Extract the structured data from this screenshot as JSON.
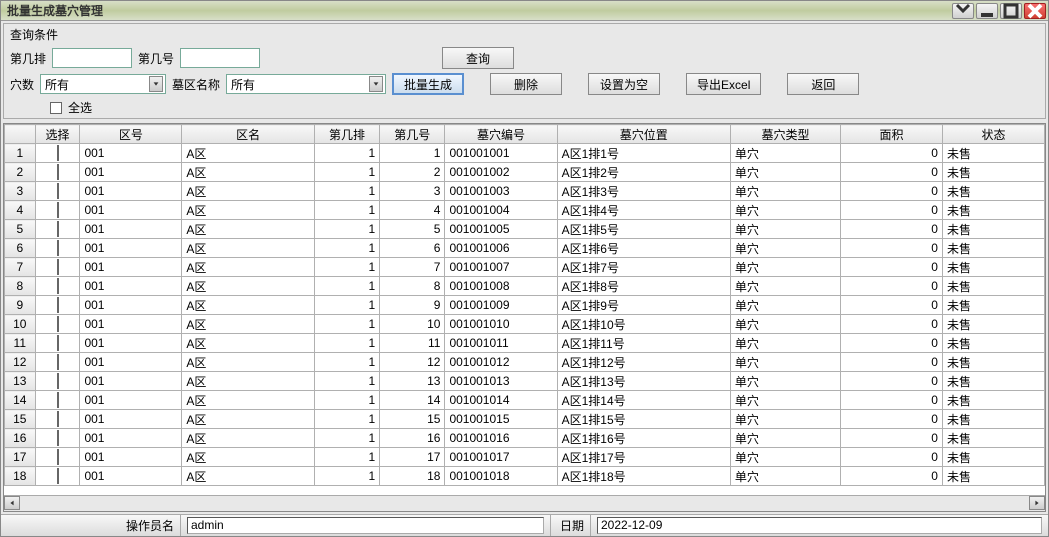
{
  "window": {
    "title": "批量生成墓穴管理"
  },
  "filter": {
    "section_label": "查询条件",
    "row_label": "第几排",
    "col_label": "第几号",
    "row_value": "",
    "col_value": "",
    "holes_label": "穴数",
    "holes_value": "所有",
    "area_name_label": "墓区名称",
    "area_name_value": "所有",
    "select_all_label": "全选"
  },
  "buttons": {
    "query": "查询",
    "batch_gen": "批量生成",
    "delete": "删除",
    "set_empty": "设置为空",
    "export_excel": "导出Excel",
    "back": "返回"
  },
  "columns": [
    "",
    "选择",
    "区号",
    "区名",
    "第几排",
    "第几号",
    "墓穴编号",
    "墓穴位置",
    "墓穴类型",
    "面积",
    "状态"
  ],
  "rows": [
    {
      "idx": 1,
      "areaNo": "001",
      "areaName": "A区",
      "row": 1,
      "col": 1,
      "code": "001001001",
      "loc": "A区1排1号",
      "type": "单穴",
      "area": 0,
      "status": "未售"
    },
    {
      "idx": 2,
      "areaNo": "001",
      "areaName": "A区",
      "row": 1,
      "col": 2,
      "code": "001001002",
      "loc": "A区1排2号",
      "type": "单穴",
      "area": 0,
      "status": "未售"
    },
    {
      "idx": 3,
      "areaNo": "001",
      "areaName": "A区",
      "row": 1,
      "col": 3,
      "code": "001001003",
      "loc": "A区1排3号",
      "type": "单穴",
      "area": 0,
      "status": "未售"
    },
    {
      "idx": 4,
      "areaNo": "001",
      "areaName": "A区",
      "row": 1,
      "col": 4,
      "code": "001001004",
      "loc": "A区1排4号",
      "type": "单穴",
      "area": 0,
      "status": "未售"
    },
    {
      "idx": 5,
      "areaNo": "001",
      "areaName": "A区",
      "row": 1,
      "col": 5,
      "code": "001001005",
      "loc": "A区1排5号",
      "type": "单穴",
      "area": 0,
      "status": "未售"
    },
    {
      "idx": 6,
      "areaNo": "001",
      "areaName": "A区",
      "row": 1,
      "col": 6,
      "code": "001001006",
      "loc": "A区1排6号",
      "type": "单穴",
      "area": 0,
      "status": "未售"
    },
    {
      "idx": 7,
      "areaNo": "001",
      "areaName": "A区",
      "row": 1,
      "col": 7,
      "code": "001001007",
      "loc": "A区1排7号",
      "type": "单穴",
      "area": 0,
      "status": "未售"
    },
    {
      "idx": 8,
      "areaNo": "001",
      "areaName": "A区",
      "row": 1,
      "col": 8,
      "code": "001001008",
      "loc": "A区1排8号",
      "type": "单穴",
      "area": 0,
      "status": "未售"
    },
    {
      "idx": 9,
      "areaNo": "001",
      "areaName": "A区",
      "row": 1,
      "col": 9,
      "code": "001001009",
      "loc": "A区1排9号",
      "type": "单穴",
      "area": 0,
      "status": "未售"
    },
    {
      "idx": 10,
      "areaNo": "001",
      "areaName": "A区",
      "row": 1,
      "col": 10,
      "code": "001001010",
      "loc": "A区1排10号",
      "type": "单穴",
      "area": 0,
      "status": "未售"
    },
    {
      "idx": 11,
      "areaNo": "001",
      "areaName": "A区",
      "row": 1,
      "col": 11,
      "code": "001001011",
      "loc": "A区1排11号",
      "type": "单穴",
      "area": 0,
      "status": "未售"
    },
    {
      "idx": 12,
      "areaNo": "001",
      "areaName": "A区",
      "row": 1,
      "col": 12,
      "code": "001001012",
      "loc": "A区1排12号",
      "type": "单穴",
      "area": 0,
      "status": "未售"
    },
    {
      "idx": 13,
      "areaNo": "001",
      "areaName": "A区",
      "row": 1,
      "col": 13,
      "code": "001001013",
      "loc": "A区1排13号",
      "type": "单穴",
      "area": 0,
      "status": "未售"
    },
    {
      "idx": 14,
      "areaNo": "001",
      "areaName": "A区",
      "row": 1,
      "col": 14,
      "code": "001001014",
      "loc": "A区1排14号",
      "type": "单穴",
      "area": 0,
      "status": "未售"
    },
    {
      "idx": 15,
      "areaNo": "001",
      "areaName": "A区",
      "row": 1,
      "col": 15,
      "code": "001001015",
      "loc": "A区1排15号",
      "type": "单穴",
      "area": 0,
      "status": "未售"
    },
    {
      "idx": 16,
      "areaNo": "001",
      "areaName": "A区",
      "row": 1,
      "col": 16,
      "code": "001001016",
      "loc": "A区1排16号",
      "type": "单穴",
      "area": 0,
      "status": "未售"
    },
    {
      "idx": 17,
      "areaNo": "001",
      "areaName": "A区",
      "row": 1,
      "col": 17,
      "code": "001001017",
      "loc": "A区1排17号",
      "type": "单穴",
      "area": 0,
      "status": "未售"
    },
    {
      "idx": 18,
      "areaNo": "001",
      "areaName": "A区",
      "row": 1,
      "col": 18,
      "code": "001001018",
      "loc": "A区1排18号",
      "type": "单穴",
      "area": 0,
      "status": "未售"
    }
  ],
  "statusbar": {
    "operator_label": "操作员名",
    "operator_value": "admin",
    "date_label": "日期",
    "date_value": "2022-12-09"
  }
}
